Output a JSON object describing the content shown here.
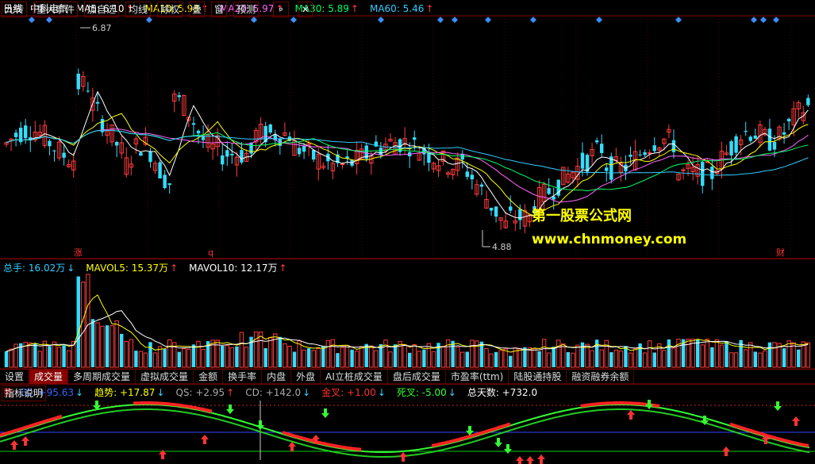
{
  "top": {
    "period": "日线",
    "stock": "中科电气",
    "ma": [
      {
        "label": "MA5: 6.10",
        "color": "#ffffff",
        "arrow": "up"
      },
      {
        "label": "MA10: 5.93",
        "color": "#ffff00",
        "arrow": "up"
      },
      {
        "label": "MA20: 5.97",
        "color": "#ff66ff",
        "arrow": "up"
      },
      {
        "label": "MA30: 5.89",
        "color": "#00ff66",
        "arrow": "up"
      },
      {
        "label": "MA60: 5.46",
        "color": "#33ccff",
        "arrow": "up"
      }
    ],
    "buttons": [
      "九转",
      "重大事件",
      "加自选",
      "均线",
      "除权",
      "叠",
      "窗",
      "预测"
    ],
    "high_label": "6.87",
    "low_label": "4.88",
    "markers": [
      "涨",
      "q",
      "财"
    ]
  },
  "volume": {
    "labels": [
      {
        "text": "总手: 16.02万",
        "color": "#33ccff",
        "arrow": "dn"
      },
      {
        "text": "MAVOL5: 15.37万",
        "color": "#ffff00",
        "arrow": "up"
      },
      {
        "text": "MAVOL10: 12.17万",
        "color": "#ffffff",
        "arrow": "up"
      }
    ]
  },
  "tabs": [
    "设置",
    "成交量",
    "多周期成交量",
    "虚拟成交量",
    "金额",
    "换手率",
    "内盘",
    "外盘",
    "AI立桩成交量",
    "盘后成交量",
    "市盈率(ttm)",
    "陆股通持股",
    "融资融券余额"
  ],
  "active_tab": "成交量",
  "indicator": {
    "labels": [
      {
        "text": "势",
        "color": "#ff3333",
        "arrow": ""
      },
      {
        "text": "CC: +95.63",
        "color": "#3366ff",
        "arrow": "dn"
      },
      {
        "text": "趋势: +17.87",
        "color": "#ffff00",
        "arrow": "dn"
      },
      {
        "text": "QS: +2.95",
        "color": "#aaaaaa",
        "arrow": "up"
      },
      {
        "text": "CD: +142.0",
        "color": "#aaaaaa",
        "arrow": "dn"
      },
      {
        "text": "金叉: +1.00",
        "color": "#ff3333",
        "arrow": "dn"
      },
      {
        "text": "死叉: -5.00",
        "color": "#33ff33",
        "arrow": "dn"
      },
      {
        "text": "总天数: +732.0",
        "color": "#ffffff",
        "arrow": ""
      }
    ],
    "help_button": "指标说明"
  },
  "watermark": {
    "line1": "第一股票公式网",
    "line2": "www.chnmoney.com"
  },
  "colors": {
    "up": "#ff3b3b",
    "down": "#33ddff",
    "grid": "#800000"
  }
}
